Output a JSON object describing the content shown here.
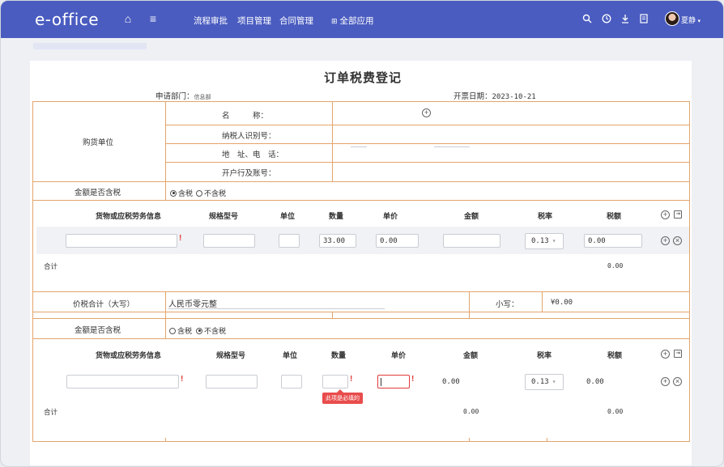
{
  "app": {
    "logo": "e-office",
    "menu": [
      "流程审批",
      "项目管理",
      "合同管理",
      "全部应用"
    ],
    "all_apps_icon": "grid-icon",
    "user": "夏静",
    "right_icons": [
      "search-icon",
      "clock-icon",
      "download-icon",
      "document-icon"
    ]
  },
  "form": {
    "title": "订单税费登记",
    "dept_label": "申请部门：",
    "dept_value": "信息部",
    "date_label": "开票日期：",
    "date_value": "2023-10-21"
  },
  "buyer": {
    "section_label": "购货单位",
    "fields": [
      "名　　　称：",
      "纳税人识别号：",
      "地　址、电　话：",
      "开户行及账号："
    ]
  },
  "tax_included": {
    "label": "金额是否含税",
    "options": [
      "含税",
      "不含税"
    ],
    "block1_selected": "含税",
    "block2_selected": "不含税"
  },
  "columns": [
    "货物或应税劳务信息",
    "规格型号",
    "单位",
    "数量",
    "单价",
    "金额",
    "税率",
    "税额"
  ],
  "block1": {
    "row": {
      "quantity": "33.00",
      "unit_price": "0.00",
      "tax_rate": "0.13",
      "tax_amount": "0.00"
    },
    "total_label": "合计",
    "total_tax": "0.00"
  },
  "summary": {
    "total_label": "价税合计（大写）",
    "total_value": "人民币零元整",
    "small_label": "小写：",
    "small_value": "¥0.00"
  },
  "block2": {
    "row": {
      "amount": "0.00",
      "tax_rate": "0.13",
      "tax_amount": "0.00"
    },
    "tooltip": "此项是必填的",
    "total_label": "合计",
    "total_amount": "0.00",
    "total_tax": "0.00"
  },
  "colors": {
    "nav": "#4a5cc0",
    "border": "#e3a56b",
    "required": "#e23b3b"
  }
}
